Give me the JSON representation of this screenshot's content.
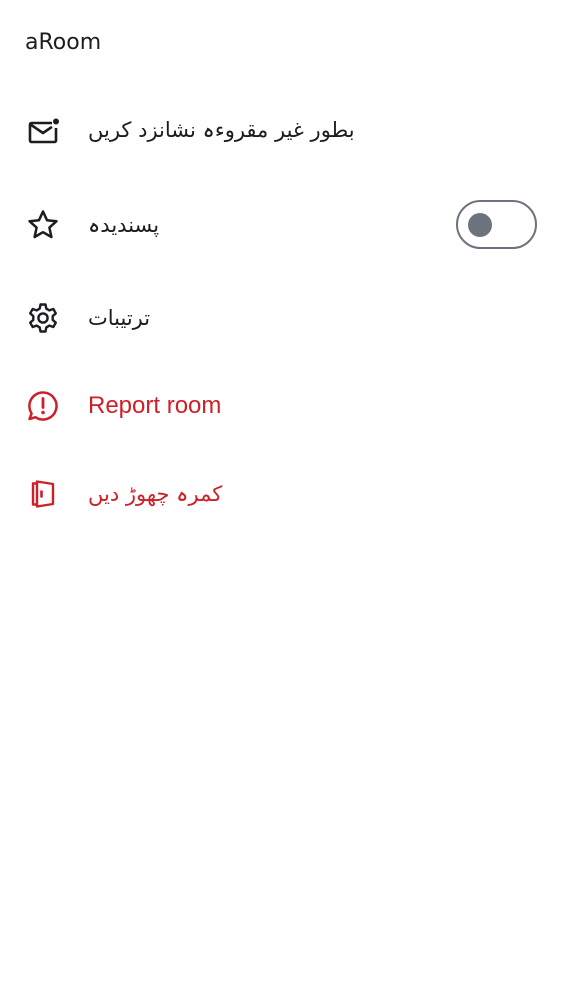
{
  "header": {
    "title": "aRoom"
  },
  "menu": {
    "mark_unread": {
      "label": "بطور غیر مقروءہ نشانزد کریں",
      "icon": "mail-unread-icon"
    },
    "favorite": {
      "label": "پسندیدہ",
      "icon": "star-icon",
      "toggle_on": false
    },
    "settings": {
      "label": "ترتیبات",
      "icon": "gear-icon"
    },
    "report": {
      "label": "Report room",
      "icon": "report-icon"
    },
    "leave": {
      "label": "کمرہ چھوڑ دیں",
      "icon": "leave-door-icon"
    }
  },
  "colors": {
    "text": "#1b1d21",
    "danger": "#ce2029",
    "toggle_off": "#6c737e",
    "background": "#ffffff"
  }
}
